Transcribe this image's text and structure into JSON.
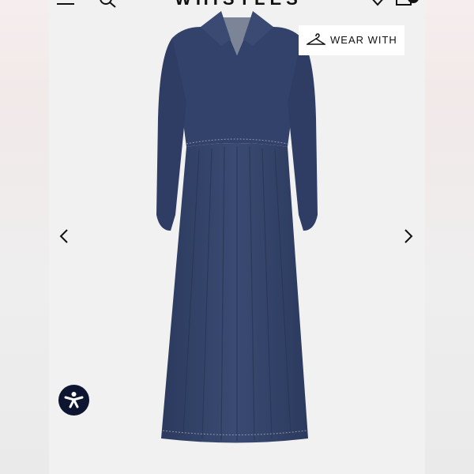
{
  "header": {
    "brand": "WHISTLES",
    "icons": [
      "menu-icon",
      "search-icon",
      "heart-icon",
      "bag-icon"
    ]
  },
  "wear_with": {
    "label": "WEAR WITH",
    "icon": "hanger-icon"
  },
  "product": {
    "image_alt": "denim-dress-image",
    "colors": {
      "denim": "#34446b",
      "denim_dark": "#283656",
      "stitch": "#8c94a8"
    }
  },
  "nav": {
    "prev_icon": "chevron-left-icon",
    "next_icon": "chevron-right-icon"
  },
  "accessibility": {
    "icon": "accessibility-icon",
    "color": "#0d1530"
  }
}
